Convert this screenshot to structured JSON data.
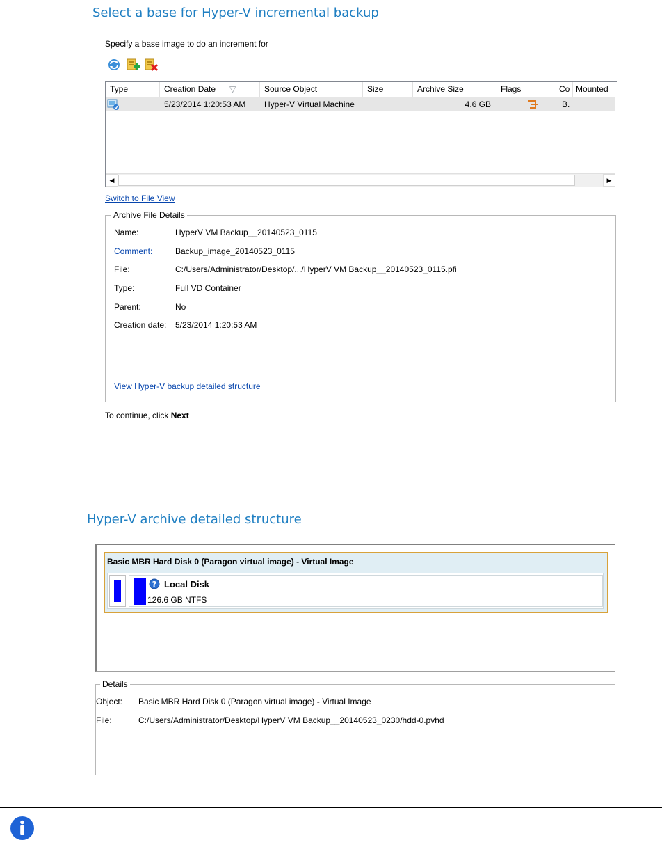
{
  "section1": {
    "title": "Select a base for Hyper-V incremental backup",
    "instruction": "Specify a base image to do an increment for",
    "toolbar": {
      "refresh": "refresh-icon",
      "add": "add-archive-icon",
      "remove": "remove-archive-icon"
    },
    "table": {
      "columns": [
        "Type",
        "Creation Date",
        "Source Object",
        "Size",
        "Archive Size",
        "Flags",
        "Co",
        "Mounted"
      ],
      "sort_indicator": "▽",
      "rows": [
        {
          "type_icon": "hyperv-vm-icon",
          "creation_date": "5/23/2014 1:20:53 AM",
          "source_object": "Hyper-V Virtual Machine",
          "size": "",
          "archive_size": "4.6 GB",
          "flags_icon": "chain-flag-icon",
          "co": "B.",
          "mounted": ""
        }
      ]
    },
    "switch_link": "Switch to File View",
    "details": {
      "legend": "Archive File Details",
      "rows": [
        {
          "label": "Name:",
          "value": "HyperV VM Backup__20140523_0115",
          "label_is_link": false
        },
        {
          "label": "Comment:",
          "value": "Backup_image_20140523_0115",
          "label_is_link": true
        },
        {
          "label": "File:",
          "value": "C:/Users/Administrator/Desktop/.../HyperV VM Backup__20140523_0115.pfi",
          "label_is_link": false
        },
        {
          "label": "Type:",
          "value": "Full VD Container",
          "label_is_link": false
        },
        {
          "label": "Parent:",
          "value": "No",
          "label_is_link": false
        },
        {
          "label": "Creation date:",
          "value": "5/23/2014 1:20:53 AM",
          "label_is_link": false
        }
      ],
      "structure_link": "View Hyper-V backup detailed structure"
    },
    "continue_prefix": "To continue, click ",
    "continue_bold": "Next"
  },
  "section2": {
    "title": "Hyper-V archive detailed structure",
    "disk": {
      "title": "Basic MBR Hard Disk 0 (Paragon virtual image) - Virtual Image",
      "partition_name": "Local Disk",
      "partition_info": "126.6 GB NTFS",
      "partition_icon": "question-icon"
    },
    "details": {
      "legend": "Details",
      "object_label": "Object:",
      "object_value": "Basic MBR Hard Disk 0 (Paragon virtual image) - Virtual Image",
      "file_label": "File:",
      "file_value": "C:/Users/Administrator/Desktop/HyperV VM Backup__20140523_0230/hdd-0.pvhd"
    }
  },
  "note": {
    "icon": "info-icon"
  },
  "colors": {
    "title": "#1f7fc2",
    "link": "#0645ad",
    "partition_blue": "#0000ff",
    "disk_border": "#d8a23a",
    "info_blue": "#1e63d6"
  }
}
